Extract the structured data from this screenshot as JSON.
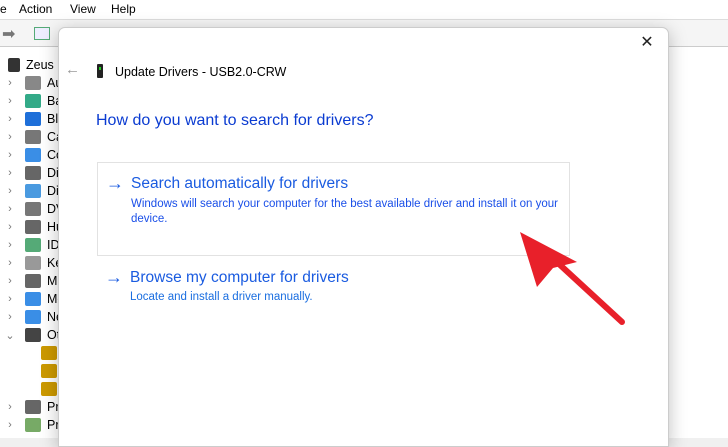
{
  "menu": [
    "e",
    "Action",
    "View",
    "Help"
  ],
  "tree": {
    "root": "Zeus",
    "items": [
      "Au",
      "Bat",
      "Blu",
      "Ca",
      "Co",
      "Dis",
      "Dis",
      "DV",
      "Hu",
      "IDE",
      "Key",
      "Mi",
      "Mo",
      "Ne",
      "Oth",
      "",
      "",
      "",
      "Pri",
      "Pro"
    ]
  },
  "dialog": {
    "title": "Update Drivers - USB2.0-CRW",
    "question": "How do you want to search for drivers?",
    "options": [
      {
        "heading": "Search automatically for drivers",
        "description": "Windows will search your computer for the best available driver and install it on your device."
      },
      {
        "heading": "Browse my computer for drivers",
        "description": "Locate and install a driver manually."
      }
    ],
    "close": "✕",
    "back": "←"
  },
  "colors": {
    "link": "#1a5be0",
    "annotation_arrow": "#e8202a"
  }
}
